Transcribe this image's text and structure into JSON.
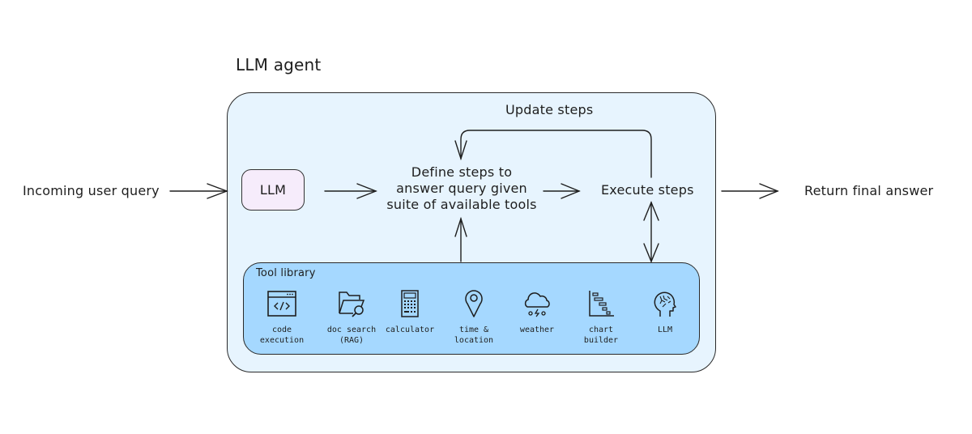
{
  "diagram": {
    "title": "LLM agent",
    "input_label": "Incoming user query",
    "output_label": "Return final answer",
    "llm_node": "LLM",
    "plan_node": "Define steps to answer query given suite of available tools",
    "plan_node_lines": [
      "Define steps to",
      "answer query given",
      "suite of available tools"
    ],
    "execute_node": "Execute steps",
    "feedback_label": "Update steps",
    "tool_library": {
      "title": "Tool library",
      "tools": [
        {
          "icon": "code-window-icon",
          "label": "code\nexecution"
        },
        {
          "icon": "folder-search-icon",
          "label": "doc search\n(RAG)"
        },
        {
          "icon": "calculator-icon",
          "label": "calculator"
        },
        {
          "icon": "map-pin-icon",
          "label": "time &\nlocation"
        },
        {
          "icon": "cloud-storm-icon",
          "label": "weather"
        },
        {
          "icon": "gantt-chart-icon",
          "label": "chart\nbuilder"
        },
        {
          "icon": "brain-head-icon",
          "label": "LLM"
        }
      ]
    },
    "colors": {
      "agent_fill": "#e7f4fe",
      "llm_fill": "#f6ecfb",
      "tool_library_fill": "#a5d8ff",
      "stroke": "#1e1e1e"
    }
  }
}
